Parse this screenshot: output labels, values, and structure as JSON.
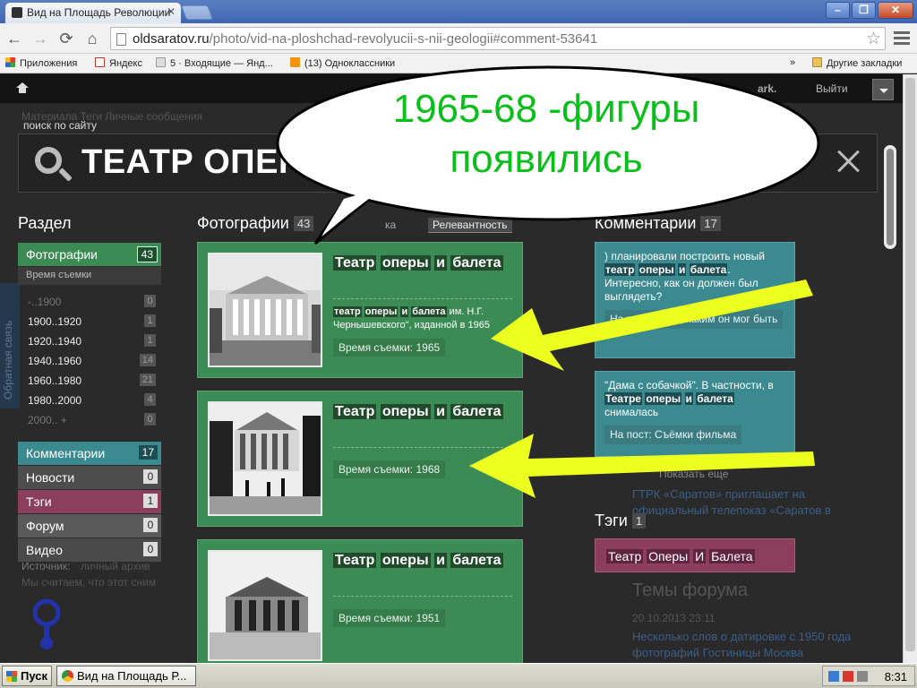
{
  "browser": {
    "tab_title": "Вид на Площадь Революции",
    "url_host": "oldsaratov.ru",
    "url_path": "/photo/vid-na-ploshchad-revolyucii-s-nii-geologii#comment-53641",
    "bookmarks": [
      "Приложения",
      "Яндекс",
      "5 · Входящие — Янд...",
      "(13) Одноклассники",
      "»",
      "Другие закладки"
    ]
  },
  "site": {
    "logout": "Выйти",
    "user_fragment": "ark.",
    "bg_nav": "Материала  Теги  Личные сообщения",
    "bg_source_label": "Источник:",
    "bg_source_value": "личный архив",
    "bg_consent": "Мы считаем, что этот сним",
    "bg_forum_title": "Темы форума",
    "bg_forum_date": "20.10.2013 23:11",
    "bg_forum_link": "Несколько слов о датировке с 1950 года фотографий Гостиницы Москва",
    "bg_news_frag": "ГТРК «Саратов» приглашает на официальный телепоказ «Саратов в",
    "feedback": "Обратная связь"
  },
  "search": {
    "label": "поиск по сайту",
    "query": "ТЕАТР ОПЕРЫ И БАЛЕТА"
  },
  "sections": {
    "title": "Раздел",
    "photos": {
      "label": "Фотографии",
      "count": "43"
    },
    "period_label": "Время съемки",
    "years": [
      {
        "label": "-..1900",
        "count": "0"
      },
      {
        "label": "1900..1920",
        "count": "1"
      },
      {
        "label": "1920..1940",
        "count": "1"
      },
      {
        "label": "1940..1960",
        "count": "14"
      },
      {
        "label": "1960..1980",
        "count": "21"
      },
      {
        "label": "1980..2000",
        "count": "4"
      },
      {
        "label": "2000.. +",
        "count": "0"
      }
    ],
    "comments": {
      "label": "Комментарии",
      "count": "17"
    },
    "news": {
      "label": "Новости",
      "count": "0"
    },
    "tags": {
      "label": "Тэги",
      "count": "1"
    },
    "forum": {
      "label": "Форум",
      "count": "0"
    },
    "video": {
      "label": "Видео",
      "count": "0"
    }
  },
  "photos": {
    "title": "Фотографии",
    "count": "43",
    "sort_label": "ка",
    "sort_value": "Релевантность",
    "items": [
      {
        "t1": "Театр",
        "t2": "оперы",
        "t3": "и",
        "t4": "балета",
        "desc_a": "театр",
        "desc_b": "оперы",
        "desc_c": "и",
        "desc_d": "балета",
        "desc_rest": "им. Н.Г. Чернышевского\", изданной в 1965",
        "year": "Время съемки: 1965"
      },
      {
        "t1": "Театр",
        "t2": "оперы",
        "t3": "и",
        "t4": "балета",
        "year": "Время съемки: 1968"
      },
      {
        "t1": "Театр",
        "t2": "оперы",
        "t3": "и",
        "t4": "балета",
        "year": "Время съемки: 1951"
      }
    ]
  },
  "comments": {
    "title": "Комментарии",
    "count": "17",
    "c1_pre": ") планировали построить новый",
    "c1_b1": "театр",
    "c1_b2": "оперы",
    "c1_b3": "и",
    "c1_b4": "балета",
    "c1_post": ". Интересно, как он должен был выглядеть?",
    "c1_link": "На пост: ...тов, каким он мог быть",
    "c2_pre": "\"Дама с собачкой\". В частности, в",
    "c2_b1": "Театре",
    "c2_b2": "оперы",
    "c2_b3": "и",
    "c2_b4": "балета",
    "c2_post": "снималась",
    "c2_link": "На пост: Съёмки фильма",
    "more": "Показать еще"
  },
  "tags": {
    "title": "Тэги",
    "count": "1",
    "t1": "Театр",
    "t2": "Оперы",
    "t3": "И",
    "t4": "Балета"
  },
  "callout": {
    "line1": "1965-68 -фигуры",
    "line2": "появились",
    "color": "#0bbf1b"
  },
  "arrow_color": "#ecff1e",
  "taskbar": {
    "start": "Пуск",
    "window": "Вид на Площадь Р...",
    "clock": "8:31"
  }
}
